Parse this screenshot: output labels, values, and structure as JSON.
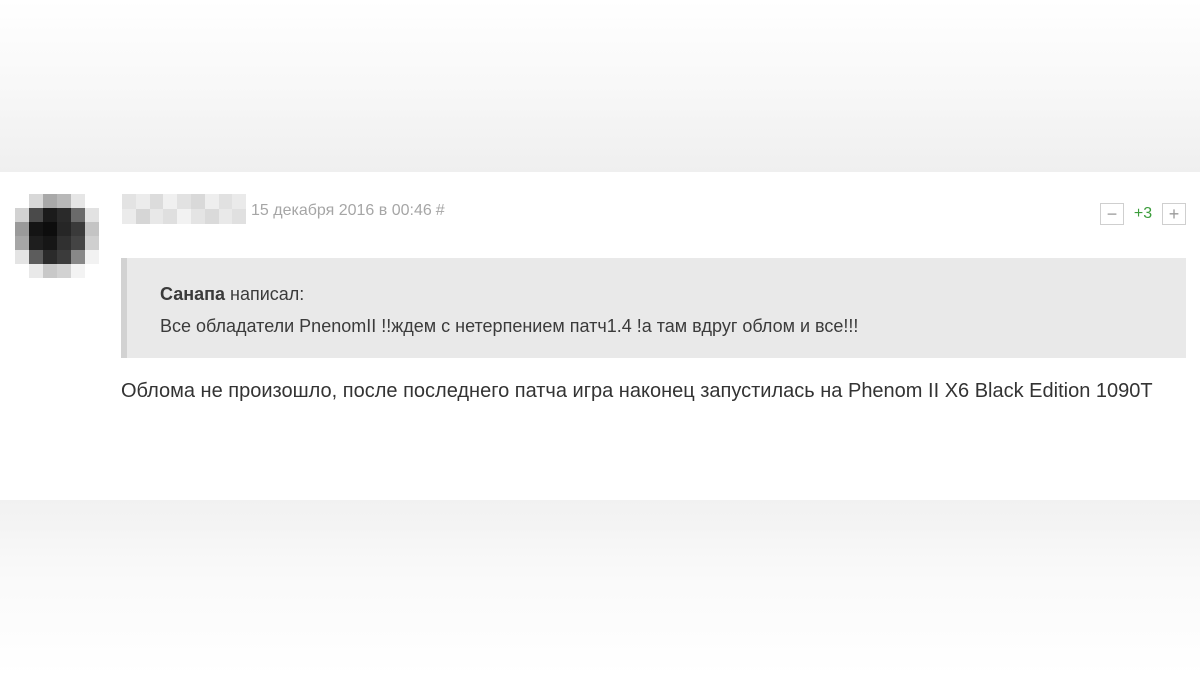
{
  "comment": {
    "date": "15 декабря 2016 в 00:46",
    "anchor": "#",
    "rating": {
      "minus": "−",
      "score": "+3",
      "plus": "+",
      "score_color": "#3c9d3c"
    },
    "quote": {
      "author": "Санапа",
      "wrote": "написал:",
      "text": "Все обладатели PnenomII !!ждем с нетерпением патч1.4 !а там вдруг облом и все!!!"
    },
    "text": "Облома не произошло, после последнего патча игра наконец запустилась на Phenom II X6 Black Edition 1090T"
  },
  "avatar_pixels": [
    "#ffffff",
    "#d8d8d8",
    "#a9a9a9",
    "#b8b8b8",
    "#e6e6e6",
    "#ffffff",
    "#d2d2d2",
    "#4a4a4a",
    "#1b1b1b",
    "#2a2a2a",
    "#6a6a6a",
    "#e2e2e2",
    "#9a9a9a",
    "#141414",
    "#0d0d0d",
    "#262626",
    "#3a3a3a",
    "#c4c4c4",
    "#a6a6a6",
    "#1e1e1e",
    "#161616",
    "#303030",
    "#444444",
    "#cfcfcf",
    "#e4e4e4",
    "#5c5c5c",
    "#2b2b2b",
    "#3b3b3b",
    "#888888",
    "#f2f2f2",
    "#ffffff",
    "#e9e9e9",
    "#c8c8c8",
    "#d2d2d2",
    "#f3f3f3",
    "#ffffff"
  ],
  "username_pixels": [
    "#e3e3e3",
    "#ececec",
    "#dcdcdc",
    "#f0f0f0",
    "#e2e2e2",
    "#d9d9d9",
    "#eeeeee",
    "#e1e1e1",
    "#eaeaea",
    "#ebebeb",
    "#d6d6d6",
    "#e8e8e8",
    "#dfdfdf",
    "#f2f2f2",
    "#e4e4e4",
    "#dadada",
    "#e9e9e9",
    "#e0e0e0"
  ]
}
